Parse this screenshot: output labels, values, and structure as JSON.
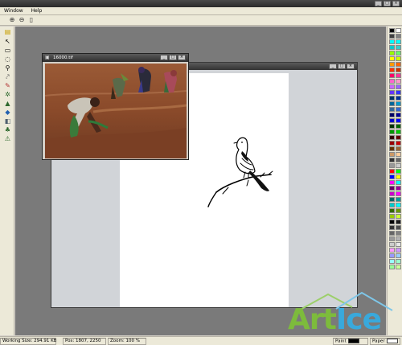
{
  "menubar": {
    "items": [
      "Window",
      "Help"
    ]
  },
  "toolbar": {
    "icons": [
      "zoom-in-icon",
      "zoom-out-icon",
      "page-icon"
    ]
  },
  "tools": [
    "layer-icon",
    "select-arrow-icon",
    "rect-select-icon",
    "lasso-icon",
    "zoom-tool-icon",
    "eyedropper-icon",
    "brush-icon",
    "clone-icon",
    "stamp-icon",
    "fill-bucket-icon",
    "eraser-icon",
    "text-icon",
    "transform-icon"
  ],
  "image_window": {
    "title": "16000.tif"
  },
  "status": {
    "working_size": "Working Size: 294.91 KB",
    "pos": "Pos: 1807, 2250",
    "zoom": "Zoom: 100 %",
    "paint_label": "Paint",
    "paper_label": "Paper"
  },
  "colors": {
    "paint": "#000000",
    "paper": "#ffffff",
    "palette": [
      "#000000",
      "#ffffff",
      "#404040",
      "#808080",
      "#00ffff",
      "#00ffff",
      "#00cccc",
      "#33cccc",
      "#99ff00",
      "#66ff66",
      "#ffff00",
      "#ccff00",
      "#ff9900",
      "#ff6600",
      "#ff3300",
      "#cc3300",
      "#ff0066",
      "#ff3399",
      "#ff66cc",
      "#ff99cc",
      "#cc66ff",
      "#9966ff",
      "#6633ff",
      "#3333ff",
      "#003366",
      "#003399",
      "#006699",
      "#0099cc",
      "#336699",
      "#3366cc",
      "#000066",
      "#000099",
      "#0000cc",
      "#0000ff",
      "#003300",
      "#006600",
      "#009900",
      "#00cc00",
      "#330000",
      "#660000",
      "#990000",
      "#cc0000",
      "#663300",
      "#996633",
      "#cc9966",
      "#ffcc99",
      "#333333",
      "#666666",
      "#999999",
      "#cccccc",
      "#ff0000",
      "#00ff00",
      "#0000ff",
      "#ffff00",
      "#ff00ff",
      "#00ffff",
      "#660066",
      "#990099",
      "#cc00cc",
      "#ff00ff",
      "#006666",
      "#009999",
      "#00cccc",
      "#00ffff",
      "#336600",
      "#669900",
      "#99cc00",
      "#ccff33",
      "#000000",
      "#1a1a1a",
      "#333333",
      "#4d4d4d",
      "#666666",
      "#808080",
      "#999999",
      "#b3b3b3",
      "#cccccc",
      "#e6e6e6",
      "#ff99ff",
      "#cc99ff",
      "#9999ff",
      "#99ccff",
      "#99ffff",
      "#99ffcc",
      "#99ff99",
      "#ccff99"
    ]
  },
  "watermark": {
    "part1": "Art",
    "part2": "Ice"
  }
}
